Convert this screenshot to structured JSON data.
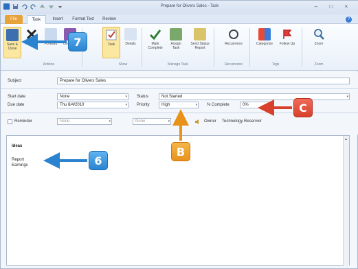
{
  "title_bar": {
    "title": "Prepare for Olivers Sales - Task"
  },
  "tabs": [
    {
      "label": "File"
    },
    {
      "label": "Task"
    },
    {
      "label": "Insert"
    },
    {
      "label": "Format Text"
    },
    {
      "label": "Review"
    }
  ],
  "ribbon": {
    "buttons": [
      {
        "label": "Save & Close"
      },
      {
        "label": "Delete"
      },
      {
        "label": "Forward"
      },
      {
        "label": "OneNote"
      },
      {
        "label": "Task"
      },
      {
        "label": "Details"
      },
      {
        "label": "Mark Complete"
      },
      {
        "label": "Assign Task"
      },
      {
        "label": "Send Status Report"
      },
      {
        "label": "Recurrence"
      },
      {
        "label": "Categorize"
      },
      {
        "label": "Follow Up"
      },
      {
        "label": "Zoom"
      }
    ],
    "groups": [
      {
        "label": "Actions"
      },
      {
        "label": "Show"
      },
      {
        "label": "Manage Task"
      },
      {
        "label": "Recurrence"
      },
      {
        "label": "Tags"
      },
      {
        "label": "Zoom"
      }
    ]
  },
  "form": {
    "subject_label": "Subject",
    "subject_value": "Prepare for Olivers Sales",
    "start_date_label": "Start date",
    "start_date_value": "None",
    "due_date_label": "Due date",
    "due_date_value": "Thu 8/4/2010",
    "status_label": "Status",
    "status_value": "Not Started",
    "priority_label": "Priority",
    "priority_value": "High",
    "complete_label": "% Complete",
    "complete_value": "0%",
    "reminder_label": "Reminder",
    "reminder_date": "None",
    "reminder_time": "None",
    "owner_label": "Owner",
    "owner_value": "Technology Reservoir"
  },
  "notes": {
    "lines": [
      "Ideas",
      "Report",
      "Earnings"
    ]
  },
  "callouts": {
    "seven": "7",
    "six": "6",
    "b": "B",
    "c": "C"
  }
}
